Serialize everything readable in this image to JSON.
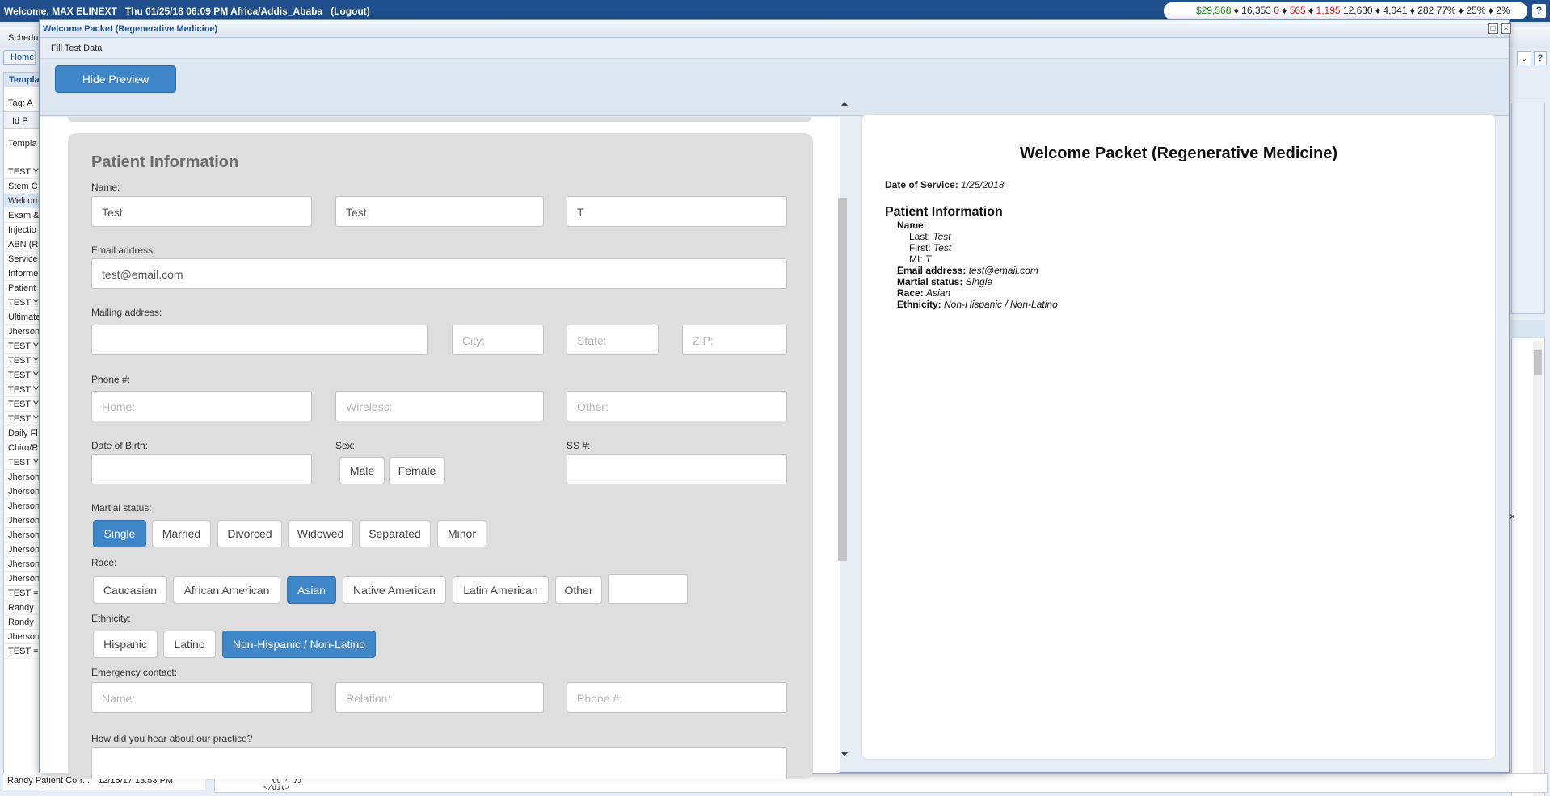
{
  "topbar": {
    "welcome": "Welcome, MAX ELINEXT",
    "datetime": "Thu 01/25/18 06:09 PM Africa/Addis_Ababa",
    "logout": "(Logout)",
    "stats": {
      "s1": "$29,568",
      "sep1": " ♦ 16,353  ",
      "s2": "0",
      "sep2": " ♦ ",
      "s3": "565",
      "sep3": " ♦ ",
      "s4": "1,195",
      "rest": "  12,630 ♦ 4,041 ♦ 282   77% ♦ 25% ♦ 2%"
    },
    "help": "?"
  },
  "background": {
    "menu_label": "Schedu",
    "tab_home": "Home",
    "panel_header": "Templa",
    "tag_label": "Tag:",
    "tag_value": "A",
    "columns": "Id    P",
    "col_template": "Templa",
    "list": [
      "TEST Y",
      "Stem C",
      "Welcom",
      "Exam &",
      "Injectio",
      "ABN (R",
      "Service",
      "Informe",
      "Patient",
      "TEST Y",
      "Ultimate",
      "Jherson",
      "TEST Y",
      "TEST Y",
      "TEST Y",
      "TEST Y",
      "TEST Y",
      "TEST Y",
      "Daily Fl",
      "Chiro/R",
      "TEST Y",
      "Jherson",
      "Jherson",
      "Jherson",
      "Jherson",
      "Jherson",
      "Jherson",
      "Jherson",
      "Jherson",
      "TEST =",
      "Randy",
      "Randy",
      "Jherson",
      "TEST ="
    ],
    "last_row_name": "Randy Patient Corr...",
    "last_row_date": "12/15/17 13:53 PM",
    "code_line1": "{{ / }}",
    "code_line2": "</div>",
    "right_help": "?",
    "right_x": "×"
  },
  "modal": {
    "title": "Welcome Packet (Regenerative Medicine)",
    "fill_test_data": "Fill Test Data",
    "hide_preview": "Hide Preview",
    "maximize_icon": "□",
    "close_icon": "×"
  },
  "form": {
    "section_title": "Patient Information",
    "name_label": "Name:",
    "name_last": "Test",
    "name_first": "Test",
    "name_mi": "T",
    "email_label": "Email address:",
    "email_value": "test@email.com",
    "mailing_label": "Mailing address:",
    "city_ph": "City:",
    "state_ph": "State:",
    "zip_ph": "ZIP:",
    "phone_label": "Phone #:",
    "phone_home_ph": "Home:",
    "phone_wireless_ph": "Wireless:",
    "phone_other_ph": "Other:",
    "dob_label": "Date of Birth:",
    "sex_label": "Sex:",
    "sex_options": [
      "Male",
      "Female"
    ],
    "ss_label": "SS #:",
    "marital_label": "Martial status:",
    "marital_options": [
      "Single",
      "Married",
      "Divorced",
      "Widowed",
      "Separated",
      "Minor"
    ],
    "marital_selected": "Single",
    "race_label": "Race:",
    "race_options": [
      "Caucasian",
      "African American",
      "Asian",
      "Native American",
      "Latin American",
      "Other"
    ],
    "race_selected": "Asian",
    "ethnicity_label": "Ethnicity:",
    "ethnicity_options": [
      "Hispanic",
      "Latino",
      "Non-Hispanic / Non-Latino"
    ],
    "ethnicity_selected": "Non-Hispanic / Non-Latino",
    "emergency_label": "Emergency contact:",
    "emergency_name_ph": "Name:",
    "emergency_relation_ph": "Relation:",
    "emergency_phone_ph": "Phone #:",
    "hear_label": "How did you hear about our practice?"
  },
  "preview": {
    "title": "Welcome Packet (Regenerative Medicine)",
    "dos_label": "Date of Service:",
    "dos_value": "1/25/2018",
    "section": "Patient Information",
    "name_label": "Name:",
    "last_label": "Last:",
    "last_value": "Test",
    "first_label": "First:",
    "first_value": "Test",
    "mi_label": "MI:",
    "mi_value": "T",
    "email_label": "Email address:",
    "email_value": "test@email.com",
    "marital_label": "Martial status:",
    "marital_value": "Single",
    "race_label": "Race:",
    "race_value": "Asian",
    "ethnicity_label": "Ethnicity:",
    "ethnicity_value": "Non-Hispanic / Non-Latino"
  },
  "colors": {
    "topbar": "#1f4f8c",
    "accent": "#3f86c8",
    "stat_green": "#1a8a1a",
    "stat_red": "#d12020"
  }
}
